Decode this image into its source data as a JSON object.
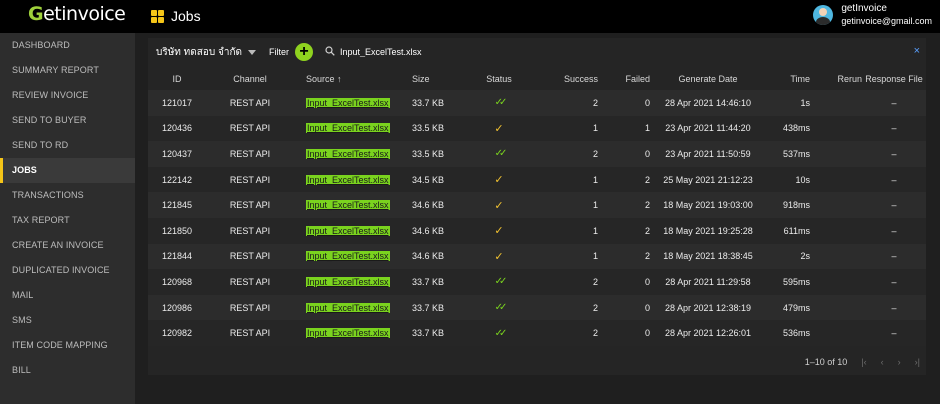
{
  "app": {
    "logo_first": "G",
    "logo_rest": "etinvoice"
  },
  "header": {
    "title": "Jobs",
    "user_name": "getInvoice",
    "user_email": "getinvoice@gmail.com"
  },
  "sidebar": {
    "items": [
      {
        "label": "DASHBOARD",
        "active": false
      },
      {
        "label": "SUMMARY REPORT",
        "active": false
      },
      {
        "label": "REVIEW INVOICE",
        "active": false
      },
      {
        "label": "SEND TO BUYER",
        "active": false
      },
      {
        "label": "SEND TO RD",
        "active": false
      },
      {
        "label": "JOBS",
        "active": true
      },
      {
        "label": "TRANSACTIONS",
        "active": false
      },
      {
        "label": "TAX REPORT",
        "active": false
      },
      {
        "label": "CREATE AN INVOICE",
        "active": false
      },
      {
        "label": "DUPLICATED INVOICE",
        "active": false
      },
      {
        "label": "MAIL",
        "active": false
      },
      {
        "label": "SMS",
        "active": false
      },
      {
        "label": "ITEM CODE MAPPING",
        "active": false
      },
      {
        "label": "BILL",
        "active": false
      }
    ]
  },
  "toolbar": {
    "company": "บริษัท ทดสอบ จำกัด",
    "filter_label": "Filter",
    "add_symbol": "+",
    "search_value": "Input_ExcelTest.xlsx",
    "clear_symbol": "×"
  },
  "table": {
    "headers": {
      "id": "ID",
      "channel": "Channel",
      "source": "Source",
      "source_sort": "↑",
      "size": "Size",
      "status": "Status",
      "success": "Success",
      "failed": "Failed",
      "date": "Generate Date",
      "time": "Time",
      "rerun": "Rerun",
      "response": "Response File"
    },
    "rows": [
      {
        "id": "121017",
        "channel": "REST API",
        "source": "Input_ExcelTest.xlsx",
        "size": "33.7 KB",
        "status": "double-check",
        "success": "2",
        "failed": "0",
        "date": "28 Apr 2021 14:46:10",
        "time": "1s",
        "rerun": "",
        "response": "–"
      },
      {
        "id": "120436",
        "channel": "REST API",
        "source": "Input_ExcelTest.xlsx",
        "size": "33.5 KB",
        "status": "check",
        "success": "1",
        "failed": "1",
        "date": "23 Apr 2021 11:44:20",
        "time": "438ms",
        "rerun": "",
        "response": "–"
      },
      {
        "id": "120437",
        "channel": "REST API",
        "source": "Input_ExcelTest.xlsx",
        "size": "33.5 KB",
        "status": "double-check",
        "success": "2",
        "failed": "0",
        "date": "23 Apr 2021 11:50:59",
        "time": "537ms",
        "rerun": "",
        "response": "–"
      },
      {
        "id": "122142",
        "channel": "REST API",
        "source": "Input_ExcelTest.xlsx",
        "size": "34.5 KB",
        "status": "check",
        "success": "1",
        "failed": "2",
        "date": "25 May 2021 21:12:23",
        "time": "10s",
        "rerun": "",
        "response": "–"
      },
      {
        "id": "121845",
        "channel": "REST API",
        "source": "Input_ExcelTest.xlsx",
        "size": "34.6 KB",
        "status": "check",
        "success": "1",
        "failed": "2",
        "date": "18 May 2021 19:03:00",
        "time": "918ms",
        "rerun": "",
        "response": "–"
      },
      {
        "id": "121850",
        "channel": "REST API",
        "source": "Input_ExcelTest.xlsx",
        "size": "34.6 KB",
        "status": "check",
        "success": "1",
        "failed": "2",
        "date": "18 May 2021 19:25:28",
        "time": "611ms",
        "rerun": "",
        "response": "–"
      },
      {
        "id": "121844",
        "channel": "REST API",
        "source": "Input_ExcelTest.xlsx",
        "size": "34.6 KB",
        "status": "check",
        "success": "1",
        "failed": "2",
        "date": "18 May 2021 18:38:45",
        "time": "2s",
        "rerun": "",
        "response": "–"
      },
      {
        "id": "120968",
        "channel": "REST API",
        "source": "Input_ExcelTest.xlsx",
        "size": "33.7 KB",
        "status": "double-check",
        "success": "2",
        "failed": "0",
        "date": "28 Apr 2021 11:29:58",
        "time": "595ms",
        "rerun": "",
        "response": "–"
      },
      {
        "id": "120986",
        "channel": "REST API",
        "source": "Input_ExcelTest.xlsx",
        "size": "33.7 KB",
        "status": "double-check",
        "success": "2",
        "failed": "0",
        "date": "28 Apr 2021 12:38:19",
        "time": "479ms",
        "rerun": "",
        "response": "–"
      },
      {
        "id": "120982",
        "channel": "REST API",
        "source": "Input_ExcelTest.xlsx",
        "size": "33.7 KB",
        "status": "double-check",
        "success": "2",
        "failed": "0",
        "date": "28 Apr 2021 12:26:01",
        "time": "536ms",
        "rerun": "",
        "response": "–"
      }
    ]
  },
  "pagination": {
    "range": "1–10 of 10",
    "first": "|‹",
    "prev": "‹",
    "next": "›",
    "last": "›|"
  },
  "colors": {
    "accent": "#f5c518",
    "green": "#7ad31e",
    "topbar": "#000000",
    "sidebar": "#2d2d2d"
  }
}
